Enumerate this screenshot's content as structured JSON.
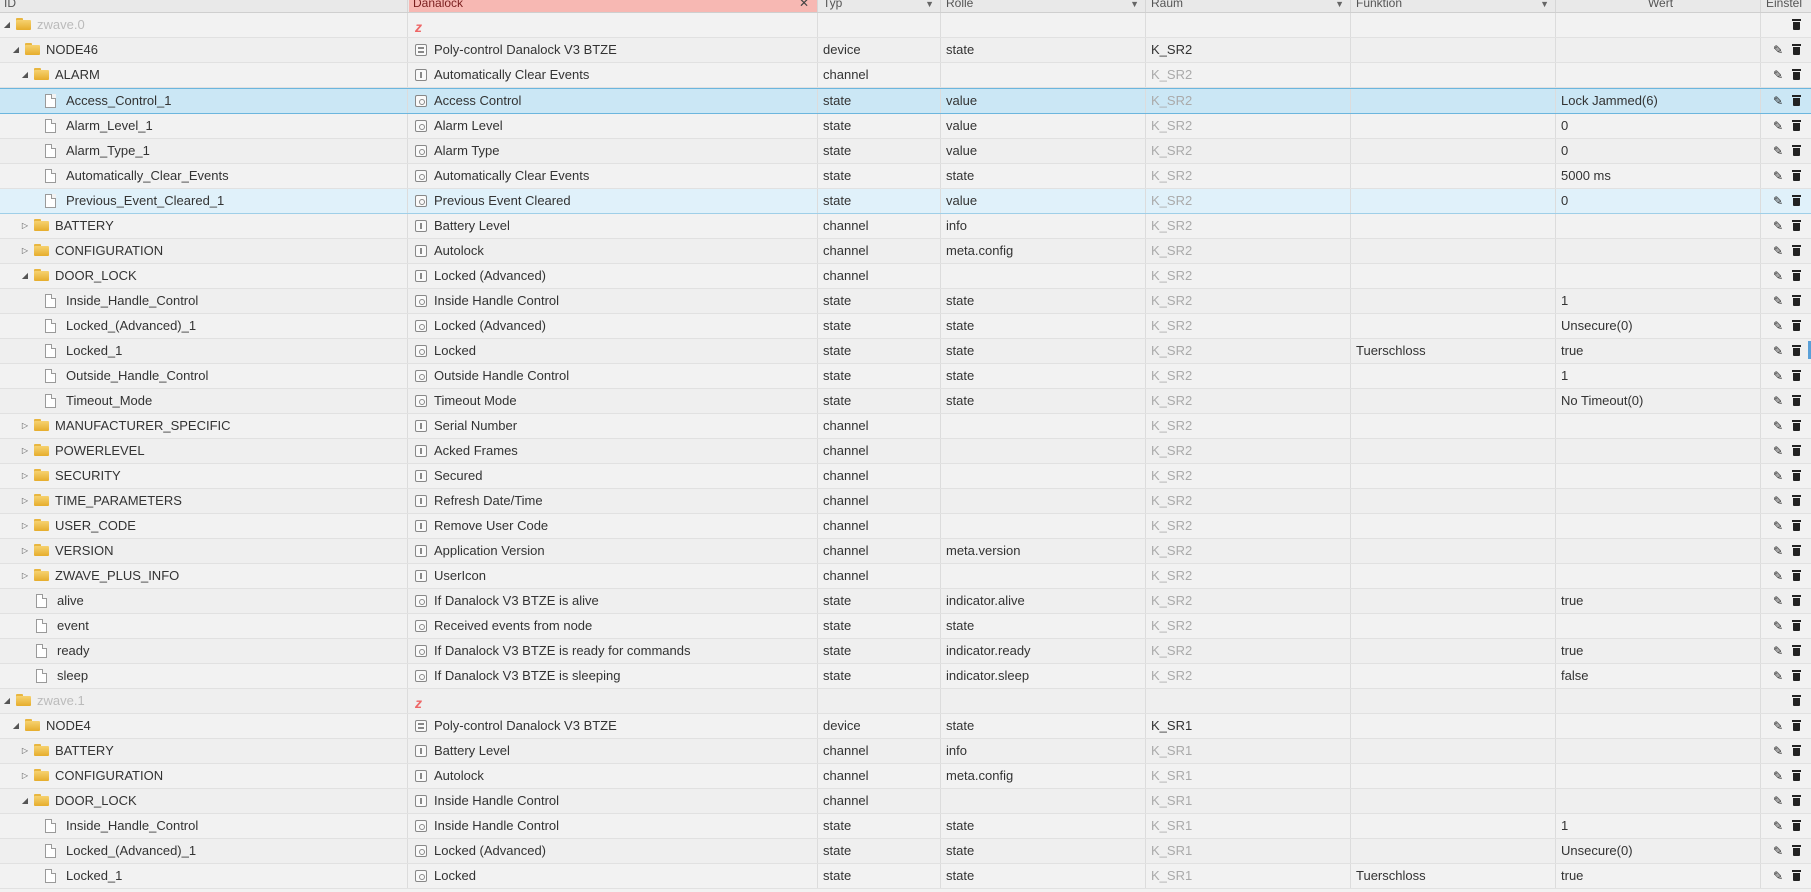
{
  "header": {
    "col_id": "ID",
    "col_name": "Danalock",
    "col_type": "Typ",
    "col_role": "Rolle",
    "col_room": "Raum",
    "col_function": "Funktion",
    "col_value": "Wert",
    "col_settings": "Einstel"
  },
  "rows": [
    {
      "id": "zwave.0",
      "level": 0,
      "kind": "folder",
      "toggle": "open",
      "dim": true,
      "icon": "zwave",
      "name": "",
      "type": "",
      "role": "",
      "room": "",
      "func": "",
      "value": "",
      "edit": false
    },
    {
      "id": "NODE46",
      "level": 1,
      "kind": "folder",
      "toggle": "open",
      "icon": "device",
      "name": "Poly-control Danalock V3 BTZE",
      "type": "device",
      "role": "state",
      "room": "K_SR2",
      "roomDark": true,
      "func": "",
      "value": "",
      "edit": true
    },
    {
      "id": "ALARM",
      "level": 2,
      "kind": "folder",
      "toggle": "open",
      "icon": "channel",
      "name": "Automatically Clear Events",
      "type": "channel",
      "role": "",
      "room": "K_SR2",
      "func": "",
      "value": "",
      "edit": true
    },
    {
      "id": "Access_Control_1",
      "level": 3,
      "kind": "file",
      "icon": "state",
      "name": "Access Control",
      "type": "state",
      "role": "value",
      "room": "K_SR2",
      "func": "",
      "value": "Lock Jammed(6)",
      "edit": true,
      "sel": "sel"
    },
    {
      "id": "Alarm_Level_1",
      "level": 3,
      "kind": "file",
      "icon": "state",
      "name": "Alarm Level",
      "type": "state",
      "role": "value",
      "room": "K_SR2",
      "func": "",
      "value": "0",
      "edit": true
    },
    {
      "id": "Alarm_Type_1",
      "level": 3,
      "kind": "file",
      "icon": "state",
      "name": "Alarm Type",
      "type": "state",
      "role": "value",
      "room": "K_SR2",
      "func": "",
      "value": "0",
      "edit": true
    },
    {
      "id": "Automatically_Clear_Events",
      "level": 3,
      "kind": "file",
      "icon": "state",
      "name": "Automatically Clear Events",
      "type": "state",
      "role": "state",
      "room": "K_SR2",
      "func": "",
      "value": "5000 ms",
      "edit": true
    },
    {
      "id": "Previous_Event_Cleared_1",
      "level": 3,
      "kind": "file",
      "icon": "state",
      "name": "Previous Event Cleared",
      "type": "state",
      "role": "value",
      "room": "K_SR2",
      "func": "",
      "value": "0",
      "edit": true,
      "sel": "sel2"
    },
    {
      "id": "BATTERY",
      "level": 2,
      "kind": "folder",
      "toggle": "closed",
      "icon": "channel",
      "name": "Battery Level",
      "type": "channel",
      "role": "info",
      "room": "K_SR2",
      "func": "",
      "value": "",
      "edit": true
    },
    {
      "id": "CONFIGURATION",
      "level": 2,
      "kind": "folder",
      "toggle": "closed",
      "icon": "channel",
      "name": "Autolock",
      "type": "channel",
      "role": "meta.config",
      "room": "K_SR2",
      "func": "",
      "value": "",
      "edit": true
    },
    {
      "id": "DOOR_LOCK",
      "level": 2,
      "kind": "folder",
      "toggle": "open",
      "icon": "channel",
      "name": "Locked (Advanced)",
      "type": "channel",
      "role": "",
      "room": "K_SR2",
      "func": "",
      "value": "",
      "edit": true
    },
    {
      "id": "Inside_Handle_Control",
      "level": 3,
      "kind": "file",
      "icon": "state",
      "name": "Inside Handle Control",
      "type": "state",
      "role": "state",
      "room": "K_SR2",
      "func": "",
      "value": "1",
      "edit": true
    },
    {
      "id": "Locked_(Advanced)_1",
      "level": 3,
      "kind": "file",
      "icon": "state",
      "name": "Locked (Advanced)",
      "type": "state",
      "role": "state",
      "room": "K_SR2",
      "func": "",
      "value": "Unsecure(0)",
      "edit": true
    },
    {
      "id": "Locked_1",
      "level": 3,
      "kind": "file",
      "icon": "state",
      "name": "Locked",
      "type": "state",
      "role": "state",
      "room": "K_SR2",
      "func": "Tuerschloss",
      "value": "true",
      "edit": true
    },
    {
      "id": "Outside_Handle_Control",
      "level": 3,
      "kind": "file",
      "icon": "state",
      "name": "Outside Handle Control",
      "type": "state",
      "role": "state",
      "room": "K_SR2",
      "func": "",
      "value": "1",
      "edit": true
    },
    {
      "id": "Timeout_Mode",
      "level": 3,
      "kind": "file",
      "icon": "state",
      "name": "Timeout Mode",
      "type": "state",
      "role": "state",
      "room": "K_SR2",
      "func": "",
      "value": "No Timeout(0)",
      "edit": true
    },
    {
      "id": "MANUFACTURER_SPECIFIC",
      "level": 2,
      "kind": "folder",
      "toggle": "closed",
      "icon": "channel",
      "name": "Serial Number",
      "type": "channel",
      "role": "",
      "room": "K_SR2",
      "func": "",
      "value": "",
      "edit": true
    },
    {
      "id": "POWERLEVEL",
      "level": 2,
      "kind": "folder",
      "toggle": "closed",
      "icon": "channel",
      "name": "Acked Frames",
      "type": "channel",
      "role": "",
      "room": "K_SR2",
      "func": "",
      "value": "",
      "edit": true
    },
    {
      "id": "SECURITY",
      "level": 2,
      "kind": "folder",
      "toggle": "closed",
      "icon": "channel",
      "name": "Secured",
      "type": "channel",
      "role": "",
      "room": "K_SR2",
      "func": "",
      "value": "",
      "edit": true
    },
    {
      "id": "TIME_PARAMETERS",
      "level": 2,
      "kind": "folder",
      "toggle": "closed",
      "icon": "channel",
      "name": "Refresh Date/Time",
      "type": "channel",
      "role": "",
      "room": "K_SR2",
      "func": "",
      "value": "",
      "edit": true
    },
    {
      "id": "USER_CODE",
      "level": 2,
      "kind": "folder",
      "toggle": "closed",
      "icon": "channel",
      "name": "Remove User Code",
      "type": "channel",
      "role": "",
      "room": "K_SR2",
      "func": "",
      "value": "",
      "edit": true
    },
    {
      "id": "VERSION",
      "level": 2,
      "kind": "folder",
      "toggle": "closed",
      "icon": "channel",
      "name": "Application Version",
      "type": "channel",
      "role": "meta.version",
      "room": "K_SR2",
      "func": "",
      "value": "",
      "edit": true
    },
    {
      "id": "ZWAVE_PLUS_INFO",
      "level": 2,
      "kind": "folder",
      "toggle": "closed",
      "icon": "channel",
      "name": "UserIcon",
      "type": "channel",
      "role": "",
      "room": "K_SR2",
      "func": "",
      "value": "",
      "edit": true
    },
    {
      "id": "alive",
      "level": 2,
      "kind": "file",
      "icon": "state",
      "name": "If Danalock V3 BTZE is alive",
      "type": "state",
      "role": "indicator.alive",
      "room": "K_SR2",
      "func": "",
      "value": "true",
      "edit": true
    },
    {
      "id": "event",
      "level": 2,
      "kind": "file",
      "icon": "state",
      "name": "Received events from node",
      "type": "state",
      "role": "state",
      "room": "K_SR2",
      "func": "",
      "value": "",
      "edit": true
    },
    {
      "id": "ready",
      "level": 2,
      "kind": "file",
      "icon": "state",
      "name": "If Danalock V3 BTZE is ready for commands",
      "type": "state",
      "role": "indicator.ready",
      "room": "K_SR2",
      "func": "",
      "value": "true",
      "edit": true
    },
    {
      "id": "sleep",
      "level": 2,
      "kind": "file",
      "icon": "state",
      "name": "If Danalock V3 BTZE is sleeping",
      "type": "state",
      "role": "indicator.sleep",
      "room": "K_SR2",
      "func": "",
      "value": "false",
      "edit": true
    },
    {
      "id": "zwave.1",
      "level": 0,
      "kind": "folder",
      "toggle": "open",
      "dim": true,
      "icon": "zwave",
      "name": "",
      "type": "",
      "role": "",
      "room": "",
      "func": "",
      "value": "",
      "edit": false
    },
    {
      "id": "NODE4",
      "level": 1,
      "kind": "folder",
      "toggle": "open",
      "icon": "device",
      "name": "Poly-control Danalock V3 BTZE",
      "type": "device",
      "role": "state",
      "room": "K_SR1",
      "roomDark": true,
      "func": "",
      "value": "",
      "edit": true
    },
    {
      "id": "BATTERY",
      "level": 2,
      "kind": "folder",
      "toggle": "closed",
      "icon": "channel",
      "name": "Battery Level",
      "type": "channel",
      "role": "info",
      "room": "K_SR1",
      "func": "",
      "value": "",
      "edit": true
    },
    {
      "id": "CONFIGURATION",
      "level": 2,
      "kind": "folder",
      "toggle": "closed",
      "icon": "channel",
      "name": "Autolock",
      "type": "channel",
      "role": "meta.config",
      "room": "K_SR1",
      "func": "",
      "value": "",
      "edit": true
    },
    {
      "id": "DOOR_LOCK",
      "level": 2,
      "kind": "folder",
      "toggle": "open",
      "icon": "channel",
      "name": "Inside Handle Control",
      "type": "channel",
      "role": "",
      "room": "K_SR1",
      "func": "",
      "value": "",
      "edit": true
    },
    {
      "id": "Inside_Handle_Control",
      "level": 3,
      "kind": "file",
      "icon": "state",
      "name": "Inside Handle Control",
      "type": "state",
      "role": "state",
      "room": "K_SR1",
      "func": "",
      "value": "1",
      "edit": true
    },
    {
      "id": "Locked_(Advanced)_1",
      "level": 3,
      "kind": "file",
      "icon": "state",
      "name": "Locked (Advanced)",
      "type": "state",
      "role": "state",
      "room": "K_SR1",
      "func": "",
      "value": "Unsecure(0)",
      "edit": true
    },
    {
      "id": "Locked_1",
      "level": 3,
      "kind": "file",
      "icon": "state",
      "name": "Locked",
      "type": "state",
      "role": "state",
      "room": "K_SR1",
      "func": "Tuerschloss",
      "value": "true",
      "edit": true
    }
  ]
}
